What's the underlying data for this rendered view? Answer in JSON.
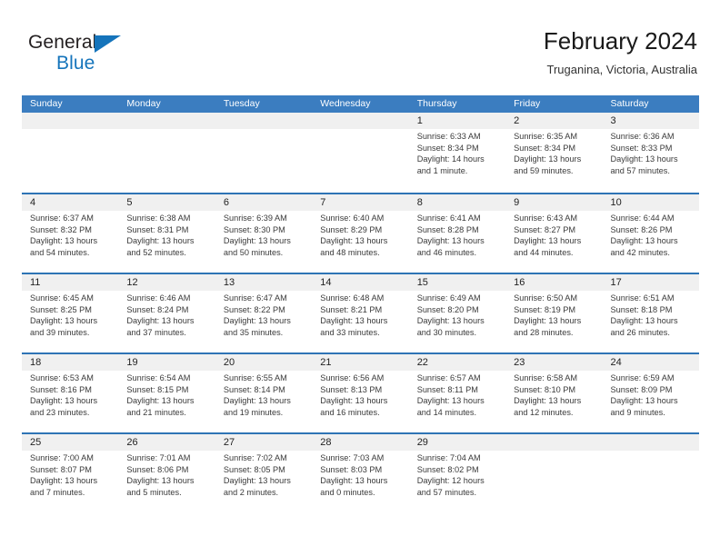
{
  "brand": {
    "name_top": "General",
    "name_bottom": "Blue",
    "triangle_color": "#1574bb",
    "text_color": "#231f20"
  },
  "header": {
    "title": "February 2024",
    "location": "Truganina, Victoria, Australia"
  },
  "theme": {
    "header_blue": "#3b7dc0",
    "row_border_blue": "#2e74b5",
    "daynum_band": "#f0f0f0"
  },
  "calendar": {
    "weekdays": [
      "Sunday",
      "Monday",
      "Tuesday",
      "Wednesday",
      "Thursday",
      "Friday",
      "Saturday"
    ],
    "weeks": [
      [
        {
          "day": "",
          "sunrise": "",
          "sunset": "",
          "daylight_1": "",
          "daylight_2": ""
        },
        {
          "day": "",
          "sunrise": "",
          "sunset": "",
          "daylight_1": "",
          "daylight_2": ""
        },
        {
          "day": "",
          "sunrise": "",
          "sunset": "",
          "daylight_1": "",
          "daylight_2": ""
        },
        {
          "day": "",
          "sunrise": "",
          "sunset": "",
          "daylight_1": "",
          "daylight_2": ""
        },
        {
          "day": "1",
          "sunrise": "Sunrise: 6:33 AM",
          "sunset": "Sunset: 8:34 PM",
          "daylight_1": "Daylight: 14 hours",
          "daylight_2": "and 1 minute."
        },
        {
          "day": "2",
          "sunrise": "Sunrise: 6:35 AM",
          "sunset": "Sunset: 8:34 PM",
          "daylight_1": "Daylight: 13 hours",
          "daylight_2": "and 59 minutes."
        },
        {
          "day": "3",
          "sunrise": "Sunrise: 6:36 AM",
          "sunset": "Sunset: 8:33 PM",
          "daylight_1": "Daylight: 13 hours",
          "daylight_2": "and 57 minutes."
        }
      ],
      [
        {
          "day": "4",
          "sunrise": "Sunrise: 6:37 AM",
          "sunset": "Sunset: 8:32 PM",
          "daylight_1": "Daylight: 13 hours",
          "daylight_2": "and 54 minutes."
        },
        {
          "day": "5",
          "sunrise": "Sunrise: 6:38 AM",
          "sunset": "Sunset: 8:31 PM",
          "daylight_1": "Daylight: 13 hours",
          "daylight_2": "and 52 minutes."
        },
        {
          "day": "6",
          "sunrise": "Sunrise: 6:39 AM",
          "sunset": "Sunset: 8:30 PM",
          "daylight_1": "Daylight: 13 hours",
          "daylight_2": "and 50 minutes."
        },
        {
          "day": "7",
          "sunrise": "Sunrise: 6:40 AM",
          "sunset": "Sunset: 8:29 PM",
          "daylight_1": "Daylight: 13 hours",
          "daylight_2": "and 48 minutes."
        },
        {
          "day": "8",
          "sunrise": "Sunrise: 6:41 AM",
          "sunset": "Sunset: 8:28 PM",
          "daylight_1": "Daylight: 13 hours",
          "daylight_2": "and 46 minutes."
        },
        {
          "day": "9",
          "sunrise": "Sunrise: 6:43 AM",
          "sunset": "Sunset: 8:27 PM",
          "daylight_1": "Daylight: 13 hours",
          "daylight_2": "and 44 minutes."
        },
        {
          "day": "10",
          "sunrise": "Sunrise: 6:44 AM",
          "sunset": "Sunset: 8:26 PM",
          "daylight_1": "Daylight: 13 hours",
          "daylight_2": "and 42 minutes."
        }
      ],
      [
        {
          "day": "11",
          "sunrise": "Sunrise: 6:45 AM",
          "sunset": "Sunset: 8:25 PM",
          "daylight_1": "Daylight: 13 hours",
          "daylight_2": "and 39 minutes."
        },
        {
          "day": "12",
          "sunrise": "Sunrise: 6:46 AM",
          "sunset": "Sunset: 8:24 PM",
          "daylight_1": "Daylight: 13 hours",
          "daylight_2": "and 37 minutes."
        },
        {
          "day": "13",
          "sunrise": "Sunrise: 6:47 AM",
          "sunset": "Sunset: 8:22 PM",
          "daylight_1": "Daylight: 13 hours",
          "daylight_2": "and 35 minutes."
        },
        {
          "day": "14",
          "sunrise": "Sunrise: 6:48 AM",
          "sunset": "Sunset: 8:21 PM",
          "daylight_1": "Daylight: 13 hours",
          "daylight_2": "and 33 minutes."
        },
        {
          "day": "15",
          "sunrise": "Sunrise: 6:49 AM",
          "sunset": "Sunset: 8:20 PM",
          "daylight_1": "Daylight: 13 hours",
          "daylight_2": "and 30 minutes."
        },
        {
          "day": "16",
          "sunrise": "Sunrise: 6:50 AM",
          "sunset": "Sunset: 8:19 PM",
          "daylight_1": "Daylight: 13 hours",
          "daylight_2": "and 28 minutes."
        },
        {
          "day": "17",
          "sunrise": "Sunrise: 6:51 AM",
          "sunset": "Sunset: 8:18 PM",
          "daylight_1": "Daylight: 13 hours",
          "daylight_2": "and 26 minutes."
        }
      ],
      [
        {
          "day": "18",
          "sunrise": "Sunrise: 6:53 AM",
          "sunset": "Sunset: 8:16 PM",
          "daylight_1": "Daylight: 13 hours",
          "daylight_2": "and 23 minutes."
        },
        {
          "day": "19",
          "sunrise": "Sunrise: 6:54 AM",
          "sunset": "Sunset: 8:15 PM",
          "daylight_1": "Daylight: 13 hours",
          "daylight_2": "and 21 minutes."
        },
        {
          "day": "20",
          "sunrise": "Sunrise: 6:55 AM",
          "sunset": "Sunset: 8:14 PM",
          "daylight_1": "Daylight: 13 hours",
          "daylight_2": "and 19 minutes."
        },
        {
          "day": "21",
          "sunrise": "Sunrise: 6:56 AM",
          "sunset": "Sunset: 8:13 PM",
          "daylight_1": "Daylight: 13 hours",
          "daylight_2": "and 16 minutes."
        },
        {
          "day": "22",
          "sunrise": "Sunrise: 6:57 AM",
          "sunset": "Sunset: 8:11 PM",
          "daylight_1": "Daylight: 13 hours",
          "daylight_2": "and 14 minutes."
        },
        {
          "day": "23",
          "sunrise": "Sunrise: 6:58 AM",
          "sunset": "Sunset: 8:10 PM",
          "daylight_1": "Daylight: 13 hours",
          "daylight_2": "and 12 minutes."
        },
        {
          "day": "24",
          "sunrise": "Sunrise: 6:59 AM",
          "sunset": "Sunset: 8:09 PM",
          "daylight_1": "Daylight: 13 hours",
          "daylight_2": "and 9 minutes."
        }
      ],
      [
        {
          "day": "25",
          "sunrise": "Sunrise: 7:00 AM",
          "sunset": "Sunset: 8:07 PM",
          "daylight_1": "Daylight: 13 hours",
          "daylight_2": "and 7 minutes."
        },
        {
          "day": "26",
          "sunrise": "Sunrise: 7:01 AM",
          "sunset": "Sunset: 8:06 PM",
          "daylight_1": "Daylight: 13 hours",
          "daylight_2": "and 5 minutes."
        },
        {
          "day": "27",
          "sunrise": "Sunrise: 7:02 AM",
          "sunset": "Sunset: 8:05 PM",
          "daylight_1": "Daylight: 13 hours",
          "daylight_2": "and 2 minutes."
        },
        {
          "day": "28",
          "sunrise": "Sunrise: 7:03 AM",
          "sunset": "Sunset: 8:03 PM",
          "daylight_1": "Daylight: 13 hours",
          "daylight_2": "and 0 minutes."
        },
        {
          "day": "29",
          "sunrise": "Sunrise: 7:04 AM",
          "sunset": "Sunset: 8:02 PM",
          "daylight_1": "Daylight: 12 hours",
          "daylight_2": "and 57 minutes."
        },
        {
          "day": "",
          "sunrise": "",
          "sunset": "",
          "daylight_1": "",
          "daylight_2": ""
        },
        {
          "day": "",
          "sunrise": "",
          "sunset": "",
          "daylight_1": "",
          "daylight_2": ""
        }
      ]
    ]
  }
}
